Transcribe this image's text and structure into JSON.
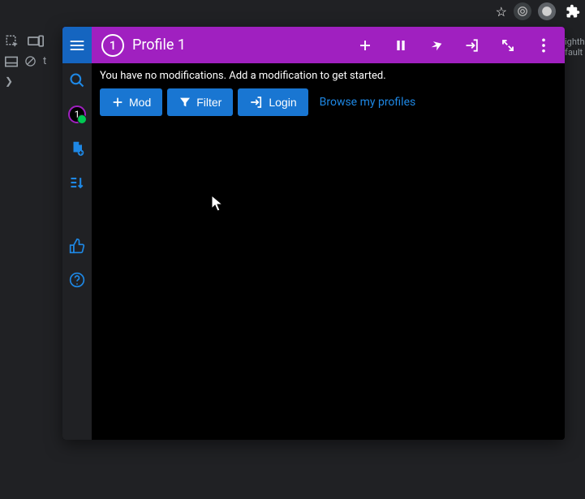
{
  "browser": {
    "partial_tab_text": "ightho\nfault"
  },
  "devtools": {
    "t_label": "t"
  },
  "appbar": {
    "profile_number": "1",
    "title": "Profile 1"
  },
  "rail": {
    "badge_number": "1"
  },
  "content": {
    "hint": "You have no modifications. Add a modification to get started.",
    "buttons": {
      "mod": "Mod",
      "filter": "Filter",
      "login": "Login"
    },
    "browse_link": "Browse my profiles"
  }
}
